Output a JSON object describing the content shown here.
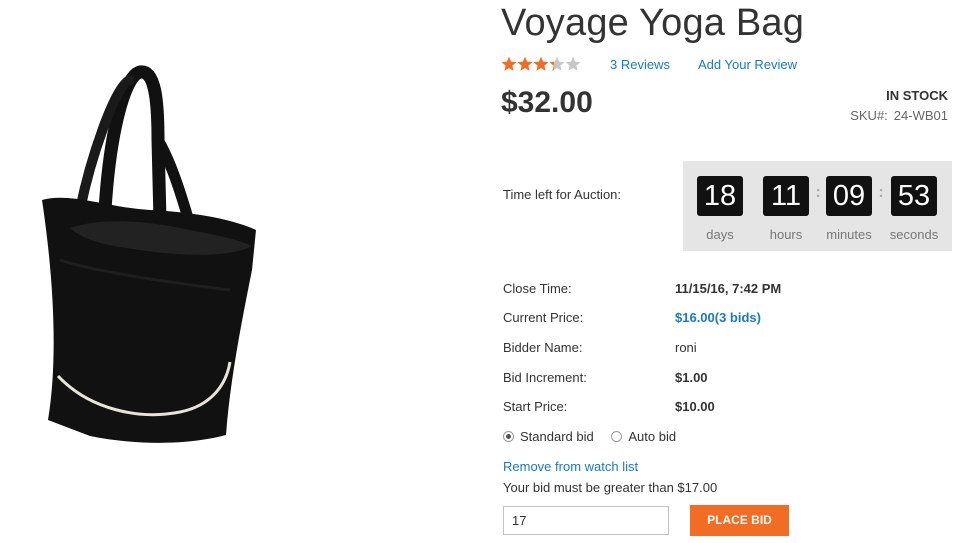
{
  "product": {
    "title": "Voyage Yoga Bag",
    "rating_fraction": 0.66,
    "reviews_link": "3 Reviews",
    "add_review_link": "Add Your Review",
    "price": "$32.00",
    "stock_status": "IN STOCK",
    "sku_label": "SKU#:",
    "sku_value": "24-WB01",
    "image_icon": "black-tote-bag-photo"
  },
  "auction": {
    "time_left_label": "Time left for Auction:",
    "timer": [
      {
        "value": "18",
        "label": "days"
      },
      {
        "value": "11",
        "label": "hours"
      },
      {
        "value": "09",
        "label": "minutes"
      },
      {
        "value": "53",
        "label": "seconds"
      }
    ],
    "details": {
      "close_time_label": "Close Time:",
      "close_time_value": "11/15/16, 7:42 PM",
      "current_price_label": "Current Price:",
      "current_price_value": "$16.00(3 bids)",
      "bidder_name_label": "Bidder Name:",
      "bidder_name_value": "roni",
      "bid_increment_label": "Bid Increment:",
      "bid_increment_value": "$1.00",
      "start_price_label": "Start Price:",
      "start_price_value": "$10.00"
    },
    "bid_types": [
      {
        "label": "Standard bid",
        "selected": true
      },
      {
        "label": "Auto bid",
        "selected": false
      }
    ],
    "watch_list_link": "Remove from watch list",
    "bid_note": "Your bid must be greater than $17.00",
    "bid_input_value": "17",
    "place_bid_label": "PLACE BID"
  },
  "colors": {
    "accent": "#f26c23",
    "link": "#1979c3",
    "star": "#f26c23",
    "timer_bg": "#e5e5e5",
    "digit_bg": "#111111"
  }
}
